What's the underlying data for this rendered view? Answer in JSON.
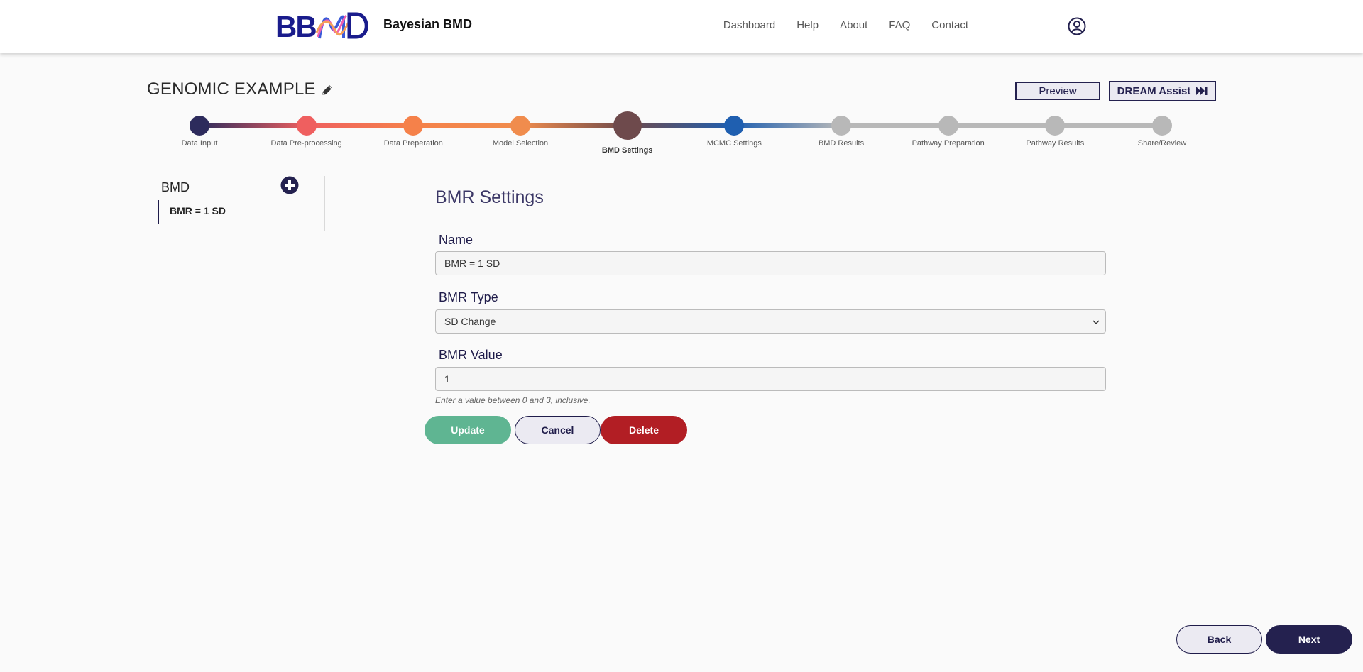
{
  "header": {
    "logo_text": "BBMD",
    "brand": "Bayesian BMD",
    "nav": [
      "Dashboard",
      "Help",
      "About",
      "FAQ",
      "Contact"
    ]
  },
  "project": {
    "title": "GENOMIC EXAMPLE",
    "preview_label": "Preview",
    "dream_label": "DREAM Assist"
  },
  "stepper": {
    "steps": [
      {
        "label": "Data Input",
        "color": "#2d2b5c"
      },
      {
        "label": "Data Pre-processing",
        "color": "#ef5f5f"
      },
      {
        "label": "Data Preperation",
        "color": "#f5814a"
      },
      {
        "label": "Model Selection",
        "color": "#f08c4d"
      },
      {
        "label": "BMD Settings",
        "color": "#6e4a4c",
        "active": true
      },
      {
        "label": "MCMC Settings",
        "color": "#1f5fb0"
      },
      {
        "label": "BMD Results",
        "color": "#b8b8b8"
      },
      {
        "label": "Pathway Preparation",
        "color": "#b8b8b8"
      },
      {
        "label": "Pathway Results",
        "color": "#b8b8b8"
      },
      {
        "label": "Share/Review",
        "color": "#b8b8b8"
      }
    ]
  },
  "sidebar": {
    "heading": "BMD",
    "items": [
      "BMR = 1 SD"
    ]
  },
  "form": {
    "title": "BMR Settings",
    "name_label": "Name",
    "name_value": "BMR = 1 SD",
    "type_label": "BMR Type",
    "type_value": "SD Change",
    "value_label": "BMR Value",
    "value_value": "1",
    "help_text": "Enter a value between 0 and 3, inclusive.",
    "update_label": "Update",
    "cancel_label": "Cancel",
    "delete_label": "Delete"
  },
  "footer": {
    "back_label": "Back",
    "next_label": "Next"
  }
}
